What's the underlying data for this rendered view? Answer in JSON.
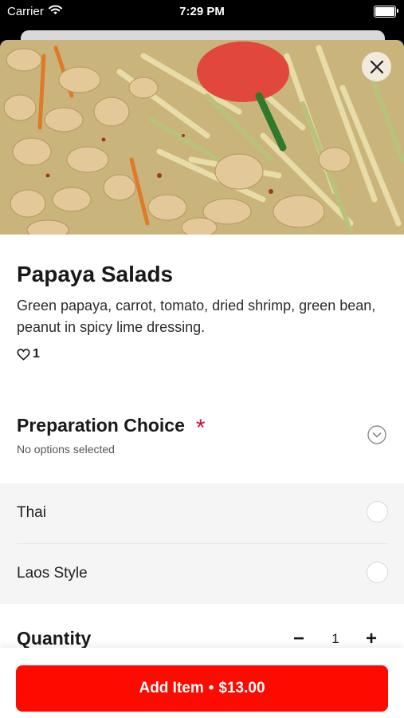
{
  "status_bar": {
    "carrier": "Carrier",
    "time": "7:29 PM"
  },
  "item": {
    "title": "Papaya Salads",
    "description": "Green papaya, carrot, tomato, dried shrimp, green bean, peanut in spicy lime dressing.",
    "like_count": "1"
  },
  "preparation": {
    "title": "Preparation Choice",
    "required_mark": "*",
    "status": "No options selected",
    "options": [
      {
        "label": "Thai",
        "selected": false
      },
      {
        "label": "Laos Style",
        "selected": false
      }
    ]
  },
  "quantity": {
    "label": "Quantity",
    "value": "1",
    "minus": "−",
    "plus": "+"
  },
  "add_button": {
    "label": "Add Item",
    "separator": "•",
    "price": "$13.00"
  },
  "colors": {
    "accent": "#ff0a00",
    "required": "#c8103a",
    "options_bg": "#f5f5f5"
  },
  "icons": [
    "wifi-icon",
    "battery-icon",
    "close-icon",
    "heart-icon",
    "chevron-down-icon"
  ]
}
